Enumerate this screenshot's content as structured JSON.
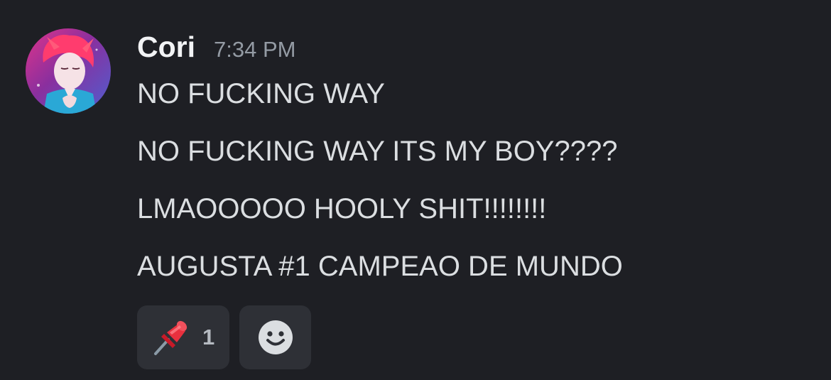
{
  "message": {
    "author": "Cori",
    "timestamp": "7:34 PM",
    "lines": [
      "NO FUCKING WAY",
      "NO FUCKING WAY ITS MY BOY????",
      "LMAOOOOO HOOLY SHIT!!!!!!!!",
      "AUGUSTA #1 CAMPEAO DE MUNDO"
    ],
    "reactions": [
      {
        "icon": "pushpin-icon",
        "count": "1"
      }
    ],
    "add_reaction_icon": "smiley-face-icon"
  },
  "colors": {
    "background": "#1e1f24",
    "username": "#f2f3f5",
    "timestamp": "#949ba4",
    "message_text": "#dbdee1",
    "reaction_bg": "#2e3036"
  }
}
